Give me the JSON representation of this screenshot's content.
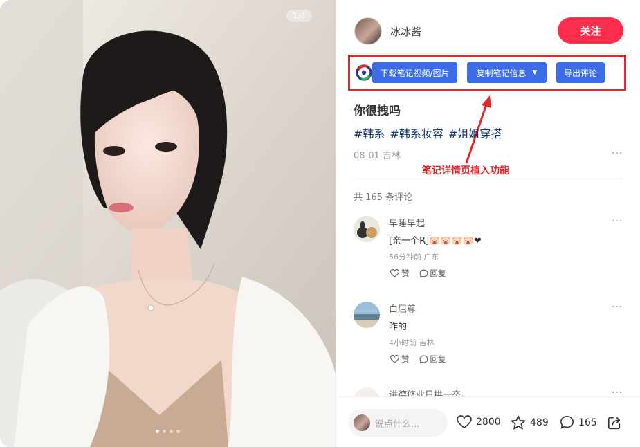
{
  "photo": {
    "page_indicator": "1/4",
    "dots": 4,
    "active_dot": 0
  },
  "author": {
    "name": "冰冰酱",
    "follow_label": "关注"
  },
  "plugin": {
    "download_label": "下载笔记视频/图片",
    "copy_label": "复制笔记信息",
    "export_label": "导出评论",
    "annotation": "笔记详情页植入功能"
  },
  "note": {
    "title": "你很拽吗",
    "tags": [
      "#韩系",
      "#韩系妆容",
      "#姐姐穿搭"
    ],
    "meta": "08-01 吉林",
    "more": "···"
  },
  "comments": {
    "count_label": "共 165 条评论",
    "items": [
      {
        "name": "早睡早起",
        "text": "[亲一个R]🐷🐷🐷🐷❤",
        "meta": "56分钟前 广东",
        "like": "赞",
        "reply": "回复",
        "more": "···"
      },
      {
        "name": "白屈尊",
        "text": "咋的",
        "meta": "4小时前 吉林",
        "like": "赞",
        "reply": "回复",
        "more": "···"
      },
      {
        "name": "讲德修业日拱一卒",
        "more": "···"
      }
    ]
  },
  "bottom": {
    "placeholder": "说点什么...",
    "likes": "2800",
    "collects": "489",
    "comments": "165"
  },
  "colors": {
    "follow": "#ff2e4d",
    "plugin_button": "#3c6de6",
    "annotation": "#e8242b",
    "tag": "#13386c"
  }
}
